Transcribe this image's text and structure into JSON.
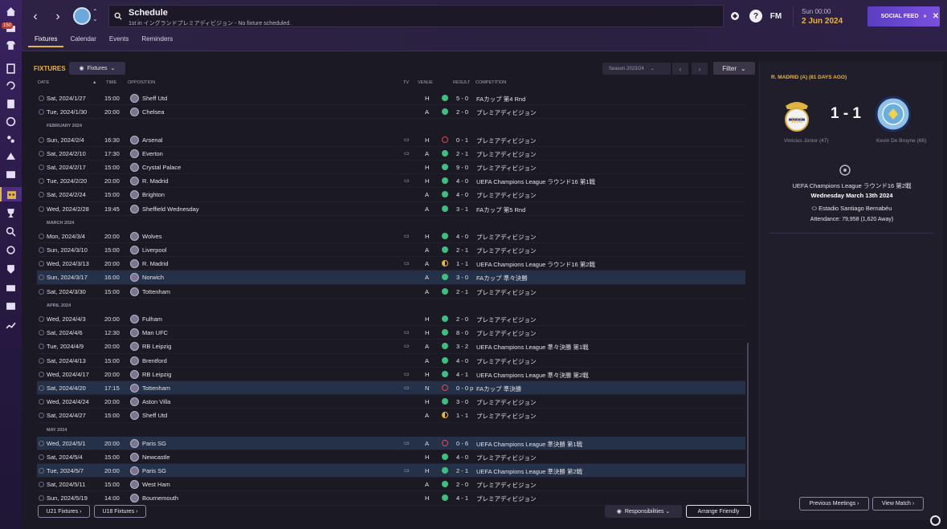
{
  "rail": {
    "badge": "150",
    "icons": [
      "home-icon",
      "inbox-icon",
      "squad-icon",
      "tactics-icon",
      "team-report-icon",
      "data-hub-icon",
      "staff-icon",
      "training-icon",
      "medical-icon",
      "dynamics-icon",
      "schedule-icon",
      "competitions-icon",
      "scouting-icon",
      "transfers-icon",
      "club-info-icon",
      "finances-icon",
      "dev-centre-icon",
      "report-icon"
    ]
  },
  "header": {
    "title": "Schedule",
    "subtitle": "1st in イングランドプレミアディビジョン - No fixture scheduled.",
    "fm_label": "FM",
    "time": "Sun 00:00",
    "date": "2 Jun 2024",
    "social_feed": "SOCIAL FEED",
    "social_arrow": "»"
  },
  "tabs": [
    "Fixtures",
    "Calendar",
    "Events",
    "Reminders"
  ],
  "fixtures": {
    "title": "FIXTURES",
    "view_dropdown": "Fixtures",
    "season": "Season 2023/24",
    "filter": "Filter",
    "columns": {
      "date": "DATE",
      "time": "TIME",
      "opposition": "OPPOSITION",
      "tv": "TV",
      "venue": "VENUE",
      "result": "RESULT",
      "competition": "COMPETITION"
    }
  },
  "rows": [
    {
      "type": "fx",
      "date": "Sat, 2024/1/27",
      "time": "15:00",
      "opp": "Sheff Utd",
      "tv": "",
      "venue": "H",
      "res": "W",
      "score": "5 - 0",
      "comp": "FAカップ 第4 Rnd",
      "hl": true
    },
    {
      "type": "fx",
      "date": "Tue, 2024/1/30",
      "time": "20:00",
      "opp": "Chelsea",
      "tv": "",
      "venue": "A",
      "res": "W",
      "score": "2 - 0",
      "comp": "プレミアディビジョン"
    },
    {
      "type": "month",
      "label": "FEBRUARY 2024"
    },
    {
      "type": "fx",
      "date": "Sun, 2024/2/4",
      "time": "16:30",
      "opp": "Arsenal",
      "tv": "▭",
      "venue": "H",
      "res": "L",
      "score": "0 - 1",
      "comp": "プレミアディビジョン"
    },
    {
      "type": "fx",
      "date": "Sat, 2024/2/10",
      "time": "17:30",
      "opp": "Everton",
      "tv": "▭",
      "venue": "A",
      "res": "W",
      "score": "2 - 1",
      "comp": "プレミアディビジョン"
    },
    {
      "type": "fx",
      "date": "Sat, 2024/2/17",
      "time": "15:00",
      "opp": "Crystal Palace",
      "tv": "",
      "venue": "H",
      "res": "W",
      "score": "9 - 0",
      "comp": "プレミアディビジョン"
    },
    {
      "type": "fx",
      "date": "Tue, 2024/2/20",
      "time": "20:00",
      "opp": "R. Madrid",
      "tv": "▭",
      "venue": "H",
      "res": "W",
      "score": "4 - 0",
      "comp": "UEFA Champions League ラウンド16 第1戦",
      "hl": true
    },
    {
      "type": "fx",
      "date": "Sat, 2024/2/24",
      "time": "15:00",
      "opp": "Brighton",
      "tv": "",
      "venue": "A",
      "res": "W",
      "score": "4 - 0",
      "comp": "プレミアディビジョン"
    },
    {
      "type": "fx",
      "date": "Wed, 2024/2/28",
      "time": "19:45",
      "opp": "Sheffield Wednesday",
      "tv": "",
      "venue": "A",
      "res": "W",
      "score": "3 - 1",
      "comp": "FAカップ 第5 Rnd",
      "hl": true
    },
    {
      "type": "month",
      "label": "MARCH 2024"
    },
    {
      "type": "fx",
      "date": "Mon, 2024/3/4",
      "time": "20:00",
      "opp": "Wolves",
      "tv": "▭",
      "venue": "H",
      "res": "W",
      "score": "4 - 0",
      "comp": "プレミアディビジョン"
    },
    {
      "type": "fx",
      "date": "Sun, 2024/3/10",
      "time": "15:00",
      "opp": "Liverpool",
      "tv": "",
      "venue": "A",
      "res": "W",
      "score": "2 - 1",
      "comp": "プレミアディビジョン"
    },
    {
      "type": "fx",
      "date": "Wed, 2024/3/13",
      "time": "20:00",
      "opp": "R. Madrid",
      "tv": "▭",
      "venue": "A",
      "res": "D",
      "score": "1 - 1",
      "comp": "UEFA Champions League ラウンド16 第2戦",
      "sel": true
    },
    {
      "type": "fx",
      "date": "Sun, 2024/3/17",
      "time": "16:00",
      "opp": "Norwich",
      "tv": "",
      "venue": "A",
      "res": "W",
      "score": "3 - 0",
      "comp": "FAカップ 準々決勝",
      "hl": true
    },
    {
      "type": "fx",
      "date": "Sat, 2024/3/30",
      "time": "15:00",
      "opp": "Tottenham",
      "tv": "",
      "venue": "A",
      "res": "W",
      "score": "2 - 1",
      "comp": "プレミアディビジョン"
    },
    {
      "type": "month",
      "label": "APRIL 2024"
    },
    {
      "type": "fx",
      "date": "Wed, 2024/4/3",
      "time": "20:00",
      "opp": "Fulham",
      "tv": "",
      "venue": "H",
      "res": "W",
      "score": "2 - 0",
      "comp": "プレミアディビジョン"
    },
    {
      "type": "fx",
      "date": "Sat, 2024/4/6",
      "time": "12:30",
      "opp": "Man UFC",
      "tv": "▭",
      "venue": "H",
      "res": "W",
      "score": "8 - 0",
      "comp": "プレミアディビジョン"
    },
    {
      "type": "fx",
      "date": "Tue, 2024/4/9",
      "time": "20:00",
      "opp": "RB Leipzig",
      "tv": "▭",
      "venue": "A",
      "res": "W",
      "score": "3 - 2",
      "comp": "UEFA Champions League 準々決勝 第1戦",
      "hl": true
    },
    {
      "type": "fx",
      "date": "Sat, 2024/4/13",
      "time": "15:00",
      "opp": "Brentford",
      "tv": "",
      "venue": "A",
      "res": "W",
      "score": "4 - 0",
      "comp": "プレミアディビジョン"
    },
    {
      "type": "fx",
      "date": "Wed, 2024/4/17",
      "time": "20:00",
      "opp": "RB Leipzig",
      "tv": "▭",
      "venue": "H",
      "res": "W",
      "score": "4 - 1",
      "comp": "UEFA Champions League 準々決勝 第2戦",
      "hl": true
    },
    {
      "type": "fx",
      "date": "Sat, 2024/4/20",
      "time": "17:15",
      "opp": "Tottenham",
      "tv": "▭",
      "venue": "N",
      "res": "L",
      "score": "0 - 0 p",
      "comp": "FAカップ 準決勝",
      "hl": true
    },
    {
      "type": "fx",
      "date": "Wed, 2024/4/24",
      "time": "20:00",
      "opp": "Aston Villa",
      "tv": "",
      "venue": "H",
      "res": "W",
      "score": "3 - 0",
      "comp": "プレミアディビジョン"
    },
    {
      "type": "fx",
      "date": "Sat, 2024/4/27",
      "time": "15:00",
      "opp": "Sheff Utd",
      "tv": "",
      "venue": "A",
      "res": "D",
      "score": "1 - 1",
      "comp": "プレミアディビジョン"
    },
    {
      "type": "month",
      "label": "MAY 2024"
    },
    {
      "type": "fx",
      "date": "Wed, 2024/5/1",
      "time": "20:00",
      "opp": "Paris SG",
      "tv": "▭",
      "venue": "A",
      "res": "L",
      "score": "0 - 6",
      "comp": "UEFA Champions League 準決勝 第1戦",
      "hl": true
    },
    {
      "type": "fx",
      "date": "Sat, 2024/5/4",
      "time": "15:00",
      "opp": "Newcastle",
      "tv": "",
      "venue": "H",
      "res": "W",
      "score": "4 - 0",
      "comp": "プレミアディビジョン"
    },
    {
      "type": "fx",
      "date": "Tue, 2024/5/7",
      "time": "20:00",
      "opp": "Paris SG",
      "tv": "▭",
      "venue": "H",
      "res": "W",
      "score": "2 - 1",
      "comp": "UEFA Champions League 準決勝 第2戦",
      "hl": true
    },
    {
      "type": "fx",
      "date": "Sat, 2024/5/11",
      "time": "15:00",
      "opp": "West Ham",
      "tv": "",
      "venue": "A",
      "res": "W",
      "score": "2 - 0",
      "comp": "プレミアディビジョン"
    },
    {
      "type": "fx",
      "date": "Sun, 2024/5/19",
      "time": "14:00",
      "opp": "Bournemouth",
      "tv": "",
      "venue": "H",
      "res": "W",
      "score": "4 - 1",
      "comp": "プレミアディビジョン"
    }
  ],
  "bottom": {
    "u21": "U21 Fixtures ›",
    "u18": "U18 Fixtures ›",
    "responsibilities": "Responsibilities ⌄",
    "arrange": "Arrange Friendly"
  },
  "match": {
    "title": "R. MADRID (A) (81 DAYS AGO)",
    "score": "1 - 1",
    "home_scorer": "Vinícius Júnior (47)",
    "away_scorer": "Kevin De Bruyne (66)",
    "competition": "UEFA Champions League ラウンド16 第2戦",
    "date": "Wednesday March 13th 2024",
    "stadium": "Estadio Santiago Bernabéu",
    "attendance": "Attendance: 79,958 (1,620 Away)",
    "prev_meetings": "Previous Meetings ›",
    "view_match": "View Match ›"
  },
  "colors": {
    "accent": "#e7b443",
    "win": "#3fbf7f",
    "loss": "#e04848",
    "social": "#6b48d6",
    "highlight_row": "#243148"
  }
}
